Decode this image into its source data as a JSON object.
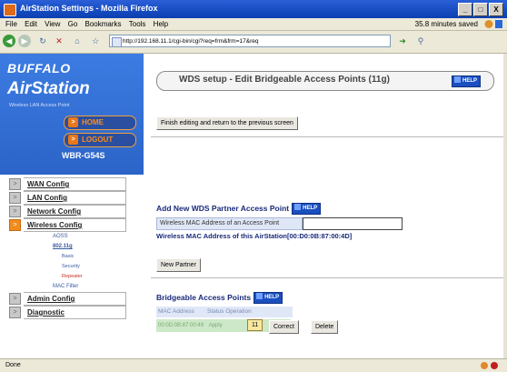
{
  "window": {
    "title": "AirStation Settings - Mozilla Firefox",
    "controls": [
      "_",
      "□",
      "X"
    ]
  },
  "menubar": {
    "items": [
      "File",
      "Edit",
      "View",
      "Go",
      "Bookmarks",
      "Tools",
      "Help"
    ],
    "status_right": "35.8 minutes saved"
  },
  "navbar": {
    "url": "http://192.168.11.1/cgi-bin/cgi?req=frm&frm=17&req"
  },
  "sidebar": {
    "brand": "BUFFALO",
    "product": "AirStation",
    "tagline": "Wireless LAN Access Point",
    "home_label": "HOME",
    "logout_label": "LOGOUT",
    "model": "WBR-G54S",
    "menu": [
      {
        "label": "WAN Config",
        "active": false
      },
      {
        "label": "LAN Config",
        "active": false
      },
      {
        "label": "Network Config",
        "active": false
      },
      {
        "label": "Wireless Config",
        "active": true
      }
    ],
    "wireless_sub": {
      "aoss": "AOSS",
      "g": "802.11g",
      "basic": "Basic",
      "security": "Security",
      "repeater": "Repeater",
      "mac_filter": "MAC Filter"
    },
    "menu_after": [
      {
        "label": "Admin Config"
      },
      {
        "label": "Diagnostic"
      }
    ]
  },
  "main": {
    "header_title": "WDS setup - Edit Bridgeable Access Points (11g)",
    "help_label": "HELP",
    "finish_button": "Finish editing and return to the previous screen",
    "add_title": "Add New WDS Partner Access Point",
    "mac_field_label": "Wireless MAC Address of an Access Point",
    "mac_field_value": "",
    "this_mac": "Wireless MAC Address of this AirStation[00:D0:0B:87:00:4D]",
    "new_partner_button": "New Partner",
    "bridgeable_title": "Bridgeable Access Points",
    "table": {
      "headers": [
        "MAC Address",
        "Status Operation"
      ],
      "row": {
        "mac": "00:0D:0B:87:00:49",
        "status": "Apply",
        "count": "11",
        "correct": "Correct",
        "delete": "Delete"
      }
    }
  },
  "statusbar": {
    "text": "Done"
  }
}
